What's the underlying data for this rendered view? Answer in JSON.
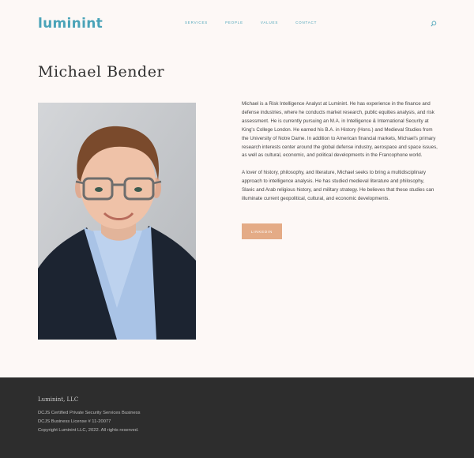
{
  "header": {
    "logo": "luminint",
    "nav": [
      "SERVICES",
      "PEOPLE",
      "VALUES",
      "CONTACT"
    ],
    "search_icon": "search-icon"
  },
  "profile": {
    "name": "Michael Bender",
    "bio": [
      "Michael is a Risk Intelligence Analyst at Luminint. He has experience in the finance and defense industries, where he conducts market research, public equities analysis, and risk assessment. He is currently pursuing an M.A. in Intelligence & International Security at King's College London. He earned his B.A. in History (Hons.) and Medieval Studies from the University of Notre Dame. In addition to American financial markets, Michael's primary research interests center around the global defense industry, aerospace and space issues, as well as cultural, economic, and political developments in the Francophone world.",
      "A lover of history, philosophy, and literature, Michael seeks to bring a multidisciplinary approach to intelligence analysis. He has studied medieval literature and philosophy, Slavic and Arab religious history, and military strategy. He believes that these studies can illuminate current geopolitical, cultural, and economic developments."
    ],
    "button": "LINKEDIN"
  },
  "footer": {
    "company": "Luminint, LLC",
    "lines": [
      "DCJS Certified Private Security Services Business",
      "DCJS Business License # 11-20077",
      "Copyright Luminint LLC, 2022.  All rights reserved."
    ]
  },
  "colors": {
    "accent": "#4aa3b8",
    "button": "#e4ab86",
    "footer_bg": "#2d2d2d",
    "page_bg": "#fdf8f6"
  }
}
